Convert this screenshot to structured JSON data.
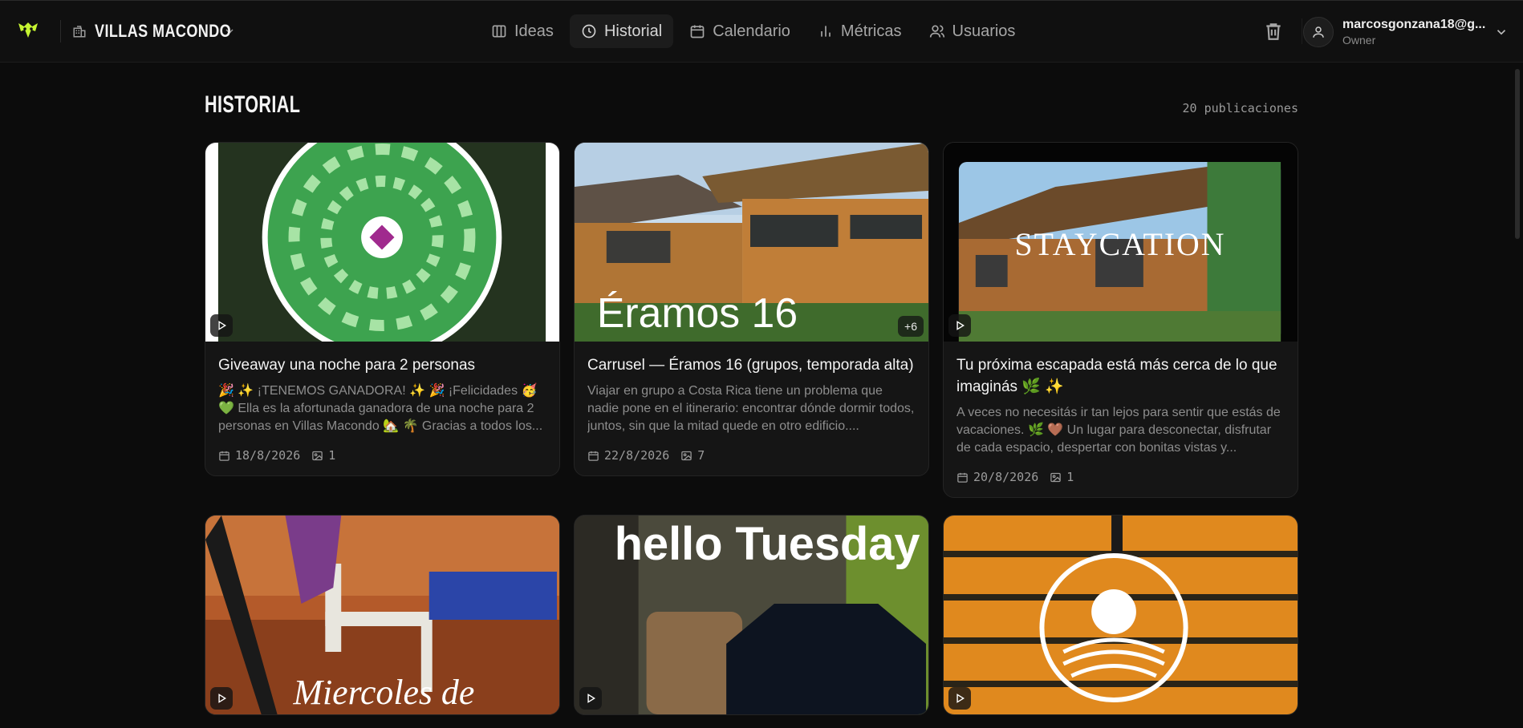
{
  "header": {
    "workspace": "VILLAS MACONDO",
    "nav": [
      {
        "label": "Ideas",
        "icon": "columns-icon"
      },
      {
        "label": "Historial",
        "icon": "clock-icon",
        "active": true
      },
      {
        "label": "Calendario",
        "icon": "calendar-icon"
      },
      {
        "label": "Métricas",
        "icon": "bar-chart-icon"
      },
      {
        "label": "Usuarios",
        "icon": "users-icon"
      }
    ],
    "user": {
      "email": "marcosgonzana18@g...",
      "role": "Owner"
    }
  },
  "page": {
    "title": "HISTORIAL",
    "count": "20 publicaciones"
  },
  "cards": [
    {
      "title": "Giveaway una noche para 2 personas",
      "description": "🎉 ✨ ¡TENEMOS GANADORA! ✨ 🎉 ¡Felicidades 🥳 💚 Ella es la afortunada ganadora de una noche para 2 personas en Villas Macondo 🏡 🌴 Gracias a todos los...",
      "date": "18/8/2026",
      "images": "1",
      "type": "video"
    },
    {
      "title": "Carrusel — Éramos 16 (grupos, temporada alta)",
      "description": "Viajar en grupo a Costa Rica tiene un problema que nadie pone en el itinerario: encontrar dónde dormir todos, juntos, sin que la mitad quede en otro edificio....",
      "date": "22/8/2026",
      "images": "7",
      "type": "carousel",
      "extra": "+6",
      "overlay_text": "Éramos 16"
    },
    {
      "title": "Tu próxima escapada está más cerca de lo que imaginás 🌿 ✨",
      "description": "A veces no necesitás ir tan lejos para sentir que estás de vacaciones. 🌿 🤎 Un lugar para desconectar, disfrutar de cada espacio, despertar con bonitas vistas y...",
      "date": "20/8/2026",
      "images": "1",
      "type": "video",
      "overlay_text": "STAYCATION"
    },
    {
      "type": "video",
      "overlay_text": "Miercoles de"
    },
    {
      "type": "video",
      "overlay_text": "hello Tuesday"
    },
    {
      "type": "video"
    }
  ],
  "colors": {
    "accent": "#c6f432",
    "bg": "#0c0c0c",
    "card": "#151515"
  }
}
